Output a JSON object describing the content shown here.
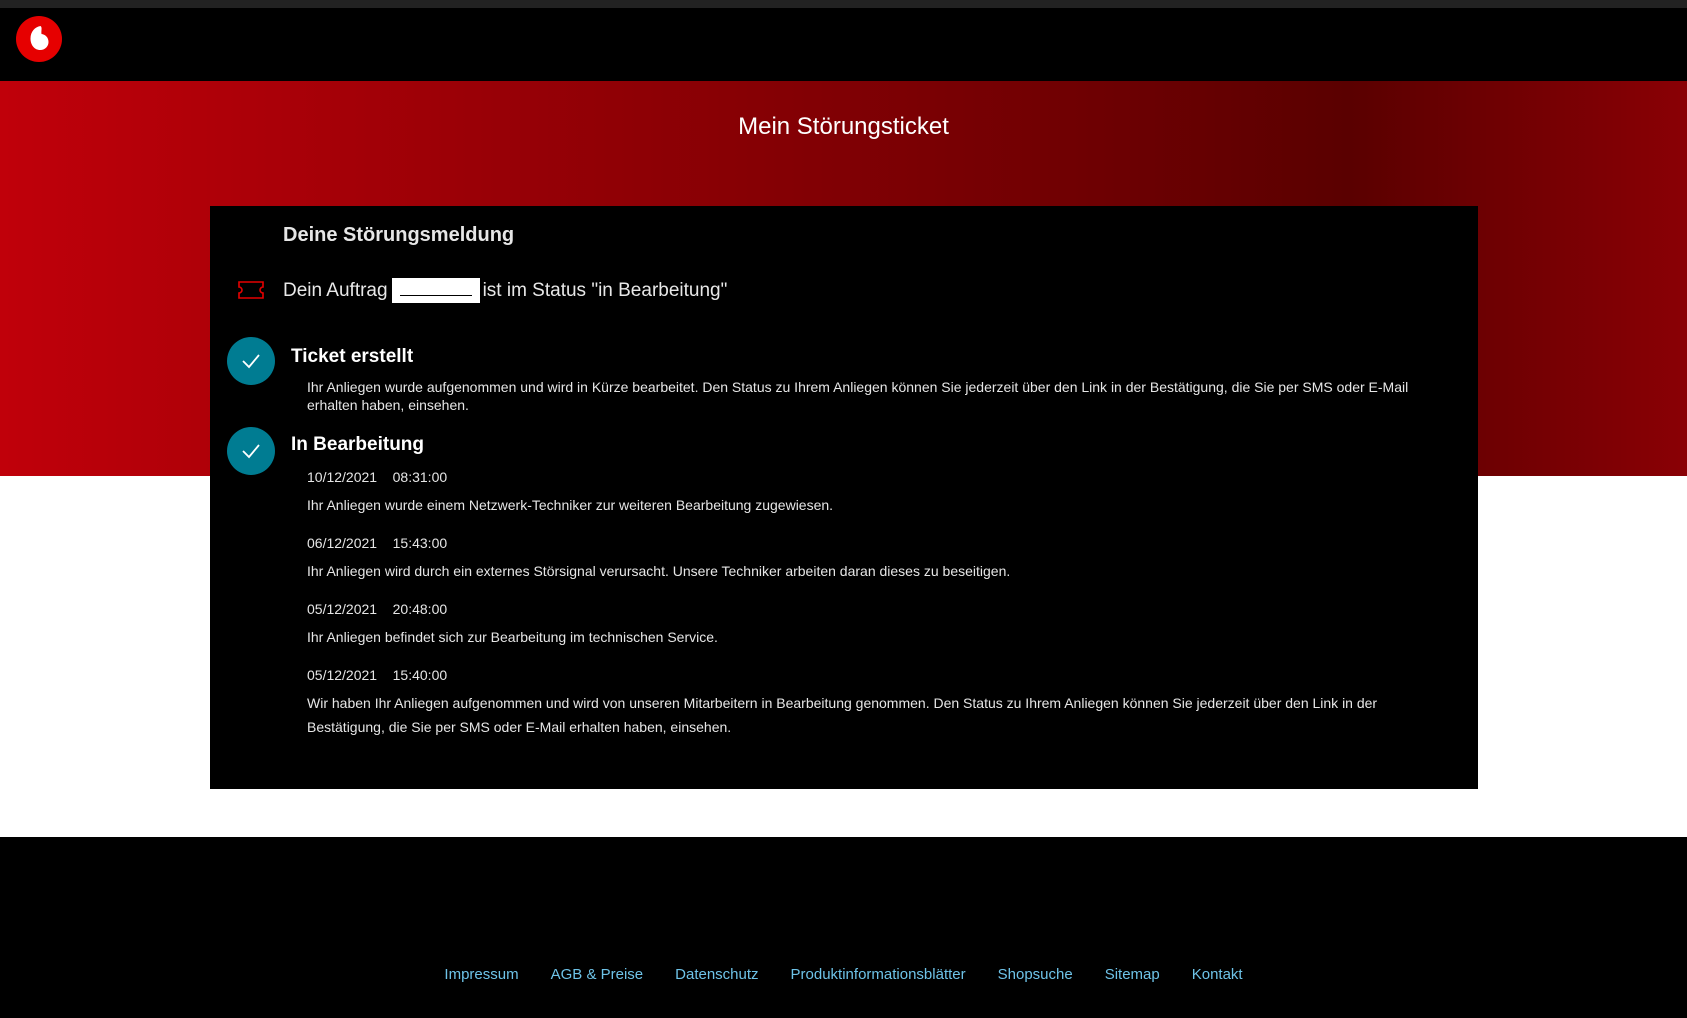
{
  "header": {
    "logo_icon": "vodafone-logo-icon"
  },
  "hero": {
    "title": "Mein Störungsticket"
  },
  "card": {
    "heading": "Deine Störungsmeldung",
    "order_prefix": "Dein Auftrag",
    "order_suffix": "ist im Status \"in Bearbeitung\"",
    "steps": [
      {
        "title": "Ticket erstellt",
        "text": "Ihr Anliegen wurde aufgenommen und wird in Kürze bearbeitet. Den Status zu Ihrem Anliegen können Sie jederzeit über den Link in der Bestätigung, die Sie per SMS oder E-Mail erhalten haben, einsehen."
      },
      {
        "title": "In Bearbeitung",
        "entries": [
          {
            "date": "10/12/2021",
            "time": "08:31:00",
            "message": "Ihr Anliegen wurde einem Netzwerk-Techniker zur weiteren Bearbeitung zugewiesen."
          },
          {
            "date": "06/12/2021",
            "time": "15:43:00",
            "message": "Ihr Anliegen wird durch ein externes Störsignal verursacht. Unsere Techniker arbeiten daran dieses zu beseitigen."
          },
          {
            "date": "05/12/2021",
            "time": "20:48:00",
            "message": "Ihr Anliegen befindet sich zur Bearbeitung im technischen Service."
          },
          {
            "date": "05/12/2021",
            "time": "15:40:00",
            "message": "Wir haben Ihr Anliegen aufgenommen und wird von unseren Mitarbeitern in Bearbeitung genommen. Den Status zu Ihrem Anliegen können Sie jederzeit über den Link in der Bestätigung, die Sie per SMS oder E-Mail erhalten haben, einsehen."
          }
        ]
      }
    ]
  },
  "footer": {
    "links": [
      "Impressum",
      "AGB & Preise",
      "Datenschutz",
      "Produktinformationsblätter",
      "Shopsuche",
      "Sitemap",
      "Kontakt"
    ]
  },
  "colors": {
    "brand_red": "#e60000",
    "step_teal": "#007c92",
    "footer_link": "#6ec3e8"
  }
}
